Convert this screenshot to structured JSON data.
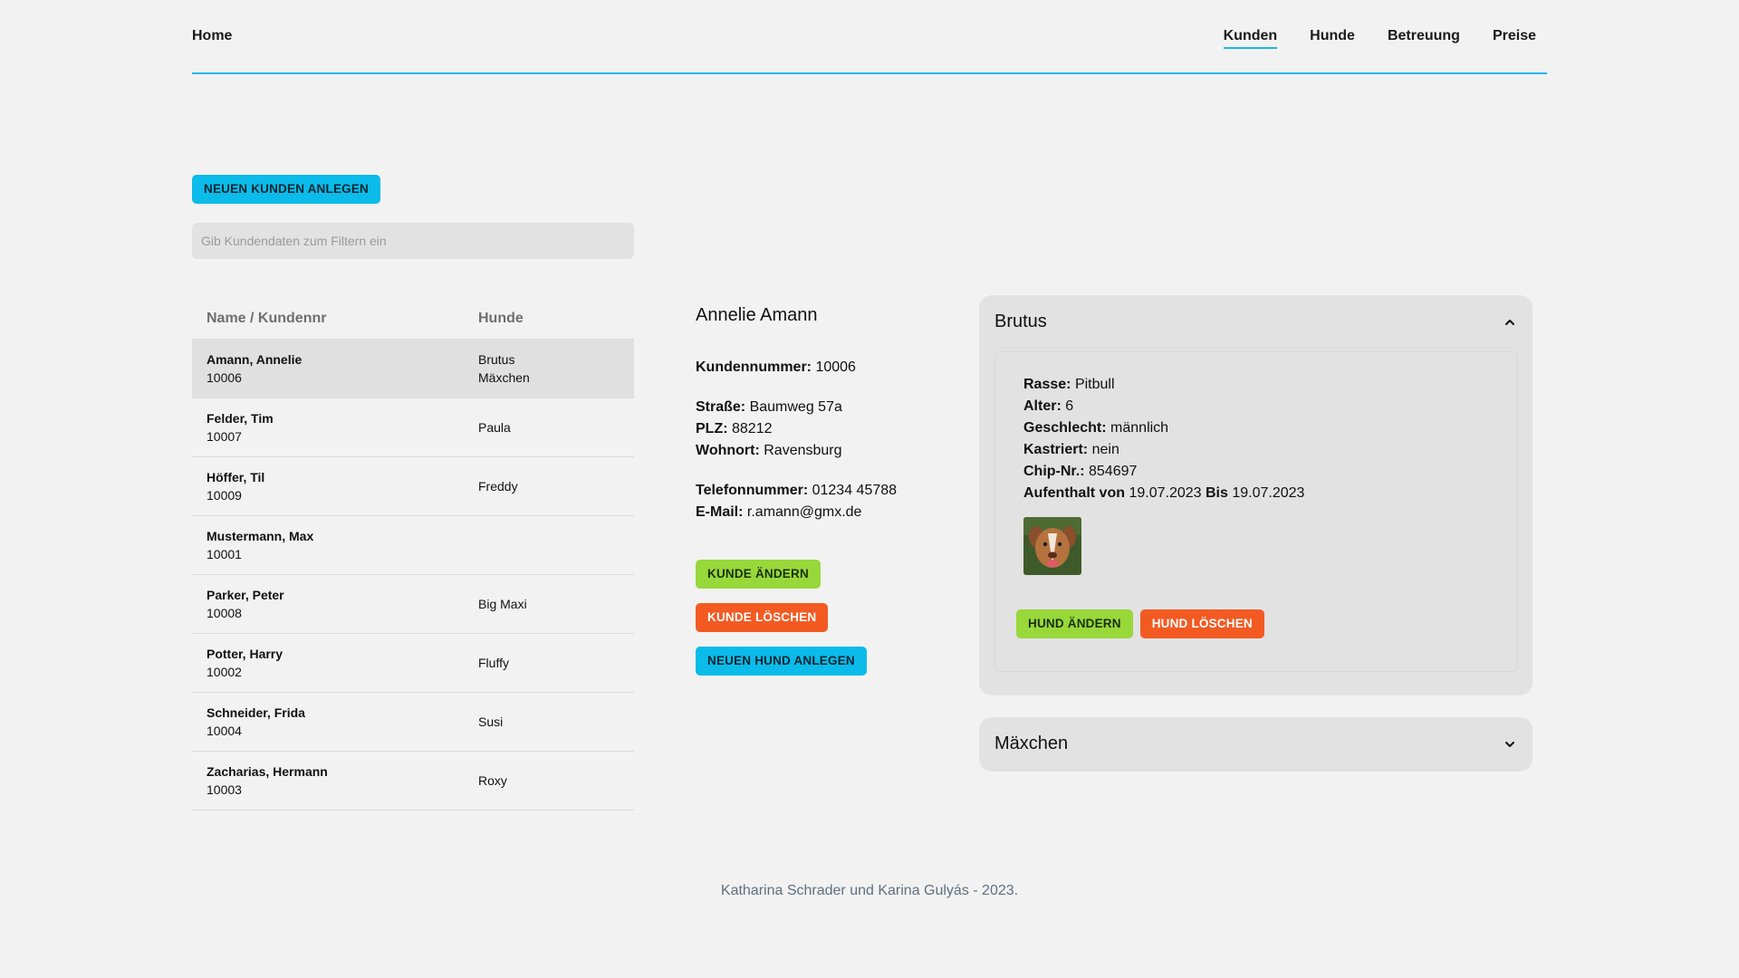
{
  "header": {
    "home": "Home",
    "nav": [
      {
        "label": "Kunden",
        "active": true
      },
      {
        "label": "Hunde",
        "active": false
      },
      {
        "label": "Betreuung",
        "active": false
      },
      {
        "label": "Preise",
        "active": false
      }
    ],
    "accent_color": "#1ab8e8"
  },
  "actions": {
    "new_customer": "NEUEN KUNDEN ANLEGEN"
  },
  "filter": {
    "placeholder": "Gib Kundendaten zum Filtern ein",
    "value": ""
  },
  "table": {
    "headers": {
      "name": "Name / Kundennr",
      "dogs": "Hunde"
    },
    "rows": [
      {
        "name": "Amann, Annelie",
        "nr": "10006",
        "dogs": [
          "Brutus",
          "Mäxchen"
        ],
        "selected": true
      },
      {
        "name": "Felder, Tim",
        "nr": "10007",
        "dogs": [
          "Paula"
        ],
        "selected": false
      },
      {
        "name": "Höffer, Til",
        "nr": "10009",
        "dogs": [
          "Freddy"
        ],
        "selected": false
      },
      {
        "name": "Mustermann, Max",
        "nr": "10001",
        "dogs": [],
        "selected": false
      },
      {
        "name": "Parker, Peter",
        "nr": "10008",
        "dogs": [
          "Big Maxi"
        ],
        "selected": false
      },
      {
        "name": "Potter, Harry",
        "nr": "10002",
        "dogs": [
          "Fluffy"
        ],
        "selected": false
      },
      {
        "name": "Schneider, Frida",
        "nr": "10004",
        "dogs": [
          "Susi"
        ],
        "selected": false
      },
      {
        "name": "Zacharias, Hermann",
        "nr": "10003",
        "dogs": [
          "Roxy"
        ],
        "selected": false
      }
    ]
  },
  "detail": {
    "name": "Annelie Amann",
    "customer_nr_label": "Kundennummer:",
    "customer_nr": "10006",
    "street_label": "Straße:",
    "street": "Baumweg 57a",
    "zip_label": "PLZ:",
    "zip": "88212",
    "city_label": "Wohnort:",
    "city": "Ravensburg",
    "phone_label": "Telefonnummer:",
    "phone": "01234 45788",
    "email_label": "E-Mail:",
    "email": "r.amann@gmx.de",
    "edit_button": "KUNDE ÄNDERN",
    "delete_button": "KUNDE LÖSCHEN",
    "new_dog_button": "NEUEN HUND ANLEGEN"
  },
  "dogs": {
    "open": {
      "name": "Brutus",
      "breed_label": "Rasse:",
      "breed": "Pitbull",
      "age_label": "Alter:",
      "age": "6",
      "sex_label": "Geschlecht:",
      "sex": "männlich",
      "neutered_label": "Kastriert:",
      "neutered": "nein",
      "chip_label": "Chip-Nr.:",
      "chip": "854697",
      "stay_from_label": "Aufenthalt von",
      "stay_from": "19.07.2023",
      "stay_to_label": "Bis",
      "stay_to": "19.07.2023",
      "photo_icon": "dog-photo",
      "edit_button": "HUND ÄNDERN",
      "delete_button": "HUND LÖSCHEN",
      "expanded": true
    },
    "closed": {
      "name": "Mäxchen",
      "expanded": false
    }
  },
  "footer": {
    "text": "Katharina Schrader und Karina Gulyás - 2023."
  },
  "colors": {
    "blue": "#0bbbe9",
    "green": "#98d83a",
    "orange": "#f25a22",
    "background": "#f2f2f2"
  }
}
